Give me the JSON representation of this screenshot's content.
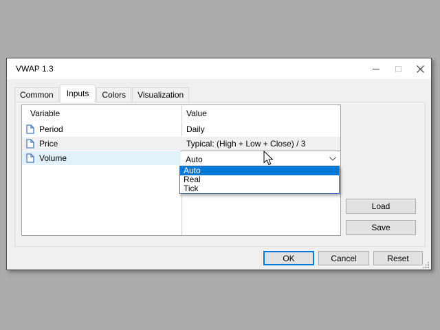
{
  "window": {
    "title": "VWAP 1.3"
  },
  "tabs": [
    {
      "label": "Common"
    },
    {
      "label": "Inputs"
    },
    {
      "label": "Colors"
    },
    {
      "label": "Visualization"
    }
  ],
  "inputs_table": {
    "headers": {
      "variable": "Variable",
      "value": "Value"
    },
    "rows": [
      {
        "variable": "Period",
        "value": "Daily"
      },
      {
        "variable": "Price",
        "value": "Typical: (High + Low + Close) / 3"
      },
      {
        "variable": "Volume",
        "value": "Auto"
      }
    ]
  },
  "dropdown": {
    "selected": "Auto",
    "options": [
      "Auto",
      "Real",
      "Tick"
    ],
    "highlighted_option": "Auto"
  },
  "side_buttons": {
    "load": "Load",
    "save": "Save"
  },
  "bottom_buttons": {
    "ok": "OK",
    "cancel": "Cancel",
    "reset": "Reset"
  },
  "colors": {
    "accent": "#0078d7",
    "selected_row": "#e3f1fb",
    "alt_row": "#f0f0f0",
    "titlebar": "#ffffff",
    "dialog_bg": "#f0f0f0",
    "button_bg": "#e1e1e1",
    "dropdown_border": "#3a6ea5",
    "desktop_bg": "#ababab"
  },
  "icons": {
    "row_icon": "document-icon",
    "combo_icon": "chevron-down-icon",
    "caption": [
      "minimize-icon",
      "maximize-icon",
      "close-icon"
    ],
    "pointer": "cursor-arrow-icon",
    "grip": "resize-grip-icon"
  }
}
